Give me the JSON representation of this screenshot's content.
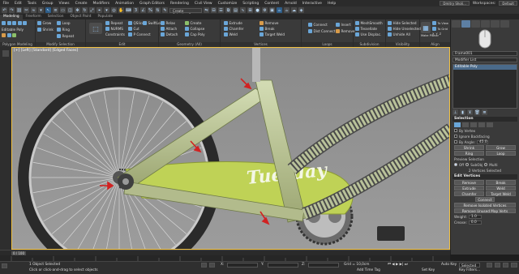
{
  "menubar": {
    "items": [
      "File",
      "Edit",
      "Tools",
      "Group",
      "Views",
      "Create",
      "Modifiers",
      "Animation",
      "Graph Editors",
      "Rendering",
      "Civil View",
      "Customize",
      "Scripting",
      "Content",
      "Arnold",
      "Interactive",
      "Help"
    ],
    "user": "Dmitry Sholi...",
    "workspaces_label": "Workspaces:",
    "workspace": "Default"
  },
  "toolbar": {
    "viewport_select": "Create Selection Se..."
  },
  "ribbon_tabs": [
    "Modeling",
    "Freeform",
    "Selection",
    "Object Paint",
    "Populate"
  ],
  "ribbon": {
    "groups": {
      "polygon_modeling": "Polygon Modeling",
      "modify_selection": "Modify Selection",
      "edit": "Edit",
      "geometry_all": "Geometry (All)",
      "vertices": "Vertices",
      "loops": "Loops",
      "subdivision": "Subdivision",
      "visibility": "Visibility",
      "align": "Align",
      "properties": "Properties"
    },
    "editable_poly": "Editable Poly",
    "grow": "Grow",
    "shrink": "Shrink",
    "loop": "Loop",
    "ring": "Ring",
    "repeat": "Repeat",
    "qslice": "QSlice",
    "swiftloop": "SwiftLoop",
    "nurms": "NURMS",
    "cut": "Cut",
    "p_connect": "P Connect",
    "constraints": "Constraints",
    "relax": "Relax",
    "create": "Create",
    "attach": "Attach",
    "collapse": "Collapse",
    "detach": "Detach",
    "cap_poly": "Cap Poly",
    "extrude": "Extrude",
    "chamfer": "Chamfer",
    "weld": "Weld",
    "remove": "Remove",
    "break": "Break",
    "target_weld": "Target Weld",
    "connect": "Connect",
    "dist_connect": "Dist Connect",
    "insert": "Insert",
    "remove_loop": "Remove",
    "meshsmooth": "MeshSmooth",
    "tessellate": "Tessellate",
    "use_displace": "Use Displac.",
    "hide_selected": "Hide Selected",
    "hide_unselected": "Hide Unselected",
    "unhide_all": "Unhide All",
    "make_planar": "Make Planar",
    "to_view": "To View",
    "to_grid": "To Grid",
    "x": "X",
    "y": "Y",
    "z": "Z"
  },
  "viewport": {
    "label": "[+] [Left] [Standard] [Edged Faces]",
    "decal_text": "Tuesday"
  },
  "command_panel": {
    "object_name": "Frame001",
    "modifier_list": "Modifier List",
    "stack_item": "Editable Poly",
    "selection_title": "Selection",
    "by_vertex": "By Vertex",
    "ignore_backfacing": "Ignore Backfacing",
    "by_angle": "By Angle:",
    "by_angle_value": "45.0",
    "shrink": "Shrink",
    "grow": "Grow",
    "ring": "Ring",
    "loop": "Loop",
    "preview_selection": "Preview Selection",
    "off": "Off",
    "subobj": "SubObj",
    "multi": "Multi",
    "selected_count": "2 Vertices Selected",
    "edit_vertices_title": "Edit Vertices",
    "remove": "Remove",
    "break": "Break",
    "extrude": "Extrude",
    "weld": "Weld",
    "chamfer": "Chamfer",
    "target_weld": "Target Weld",
    "connect": "Connect",
    "remove_isolated": "Remove Isolated Vertices",
    "remove_unused_map": "Remove Unused Map Verts",
    "weight_label": "Weight:",
    "weight_value": "1.0",
    "crease_label": "Crease:",
    "crease_value": "0.0"
  },
  "timeline": {
    "frame": "0 / 100"
  },
  "status": {
    "object_selected": "1 Object Selected",
    "prompt": "Click or click-and-drag to select objects",
    "x_label": "X:",
    "y_label": "Y:",
    "z_label": "Z:",
    "grid": "Grid = 10,0cm",
    "add_time_tag": "Add Time Tag",
    "auto_key": "Auto Key",
    "selected": "Selected",
    "set_key": "Set Key",
    "key_filters": "Key Filters..."
  },
  "colors": {
    "viewport_bg": "#8e8e8e",
    "frame_green": "#b5c48f",
    "chainguard": "#bcd15a",
    "accent": "#5d7fa3"
  }
}
